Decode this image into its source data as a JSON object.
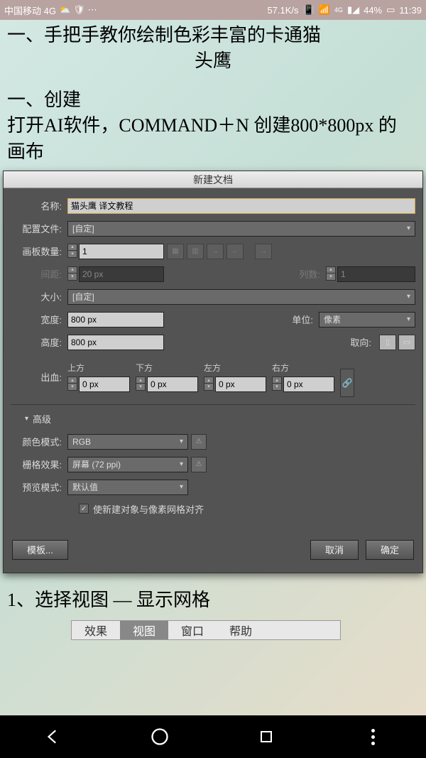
{
  "status": {
    "carrier": "中国移动 4G",
    "speed": "57.1K/s",
    "signal_label": "4G",
    "battery": "44%",
    "time": "11:39"
  },
  "article": {
    "title_l1": "一、手把手教你绘制色彩丰富的卡通猫",
    "title_l2": "头鹰",
    "section": "一、创建",
    "body_l1": "打开AI软件，COMMAND＋N 创建800*800px 的",
    "body_l2": "画布",
    "step1": "1、选择视图 — 显示网格"
  },
  "dialog": {
    "title": "新建文档",
    "name_lbl": "名称:",
    "name": "猫头鹰 译文教程",
    "profile_lbl": "配置文件:",
    "profile": "[自定]",
    "artboards_lbl": "画板数量:",
    "artboards": "1",
    "spacing_lbl": "间距:",
    "spacing": "20 px",
    "columns_lbl": "列数:",
    "columns": "1",
    "size_lbl": "大小:",
    "size": "[自定]",
    "width_lbl": "宽度:",
    "width": "800 px",
    "unit_lbl": "单位:",
    "unit": "像素",
    "height_lbl": "高度:",
    "height": "800 px",
    "orient_lbl": "取向:",
    "bleed_lbl": "出血:",
    "bleed_top": "上方",
    "bleed_bottom": "下方",
    "bleed_left": "左方",
    "bleed_right": "右方",
    "bleed_val": "0 px",
    "advanced": "高级",
    "color_mode_lbl": "颜色模式:",
    "color_mode": "RGB",
    "raster_lbl": "栅格效果:",
    "raster": "屏幕 (72 ppi)",
    "preview_lbl": "预览模式:",
    "preview": "默认值",
    "align_chk": "使新建对象与像素网格对齐",
    "template_btn": "模板...",
    "cancel_btn": "取消",
    "ok_btn": "确定"
  },
  "menu": {
    "effect": "效果",
    "view": "视图",
    "window": "窗口",
    "help": "帮助"
  }
}
